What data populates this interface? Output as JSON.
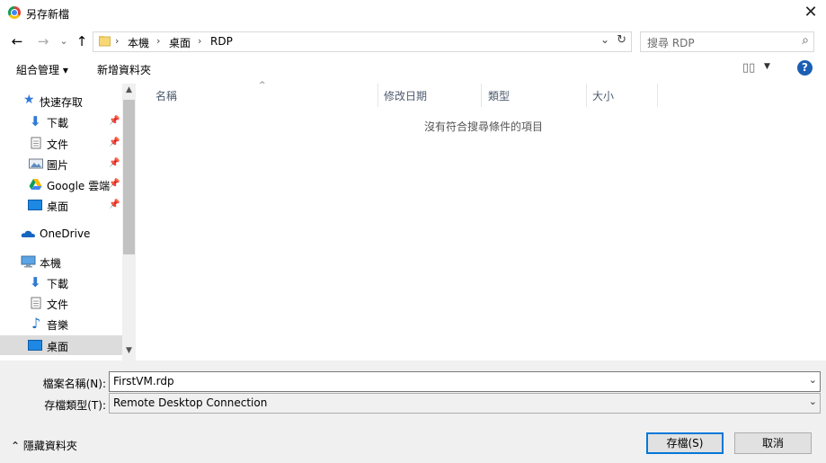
{
  "window": {
    "title": "另存新檔",
    "close": "✕"
  },
  "nav": {
    "back": "←",
    "forward": "→",
    "recent": "⌄",
    "up": "↑",
    "breadcrumb": [
      "本機",
      "桌面",
      "RDP"
    ],
    "crumb_sep": "›",
    "address_dropdown": "⌄",
    "refresh": "↻",
    "search_placeholder": "搜尋 RDP",
    "search_icon": "⌕"
  },
  "toolbar": {
    "organize": "組合管理 ▾",
    "new_folder": "新增資料夾",
    "view_icon": "▯▯",
    "view_dropdown": "▼",
    "help": "?"
  },
  "sidebar": {
    "items": [
      {
        "label": "快速存取",
        "icon": "star-icon",
        "pinned": false
      },
      {
        "label": "下載",
        "icon": "download-icon",
        "pinned": true
      },
      {
        "label": "文件",
        "icon": "document-icon",
        "pinned": true
      },
      {
        "label": "圖片",
        "icon": "pictures-icon",
        "pinned": true
      },
      {
        "label": "Google 雲端",
        "icon": "google-drive-icon",
        "pinned": true
      },
      {
        "label": "桌面",
        "icon": "desktop-icon",
        "pinned": true
      },
      {
        "label": "OneDrive",
        "icon": "onedrive-icon",
        "pinned": false
      },
      {
        "label": "本機",
        "icon": "this-pc-icon",
        "pinned": false
      },
      {
        "label": "下載",
        "icon": "download-icon",
        "pinned": false
      },
      {
        "label": "文件",
        "icon": "document-icon",
        "pinned": false
      },
      {
        "label": "音樂",
        "icon": "music-icon",
        "pinned": false
      },
      {
        "label": "桌面",
        "icon": "desktop-icon",
        "pinned": false,
        "selected": true
      }
    ],
    "pin_glyph": "📌",
    "scroll_up": "▲",
    "scroll_down": "▼"
  },
  "filelist": {
    "columns": [
      "名稱",
      "修改日期",
      "類型",
      "大小"
    ],
    "sort_arrow": "^",
    "empty_message": "沒有符合搜尋條件的項目"
  },
  "form": {
    "filename_label": "檔案名稱(N):",
    "filename_value": "FirstVM.rdp",
    "filetype_label": "存檔類型(T):",
    "filetype_value": "Remote Desktop Connection",
    "dropdown_glyph": "⌄"
  },
  "footer": {
    "hide_folders": "⌃  隱藏資料夾",
    "save": "存檔(S)",
    "cancel": "取消"
  },
  "colors": {
    "accent": "#0078d7",
    "selected_bg": "#dcdcdc",
    "panel_bg": "#f0f0f0",
    "folder": "#f8d775"
  }
}
